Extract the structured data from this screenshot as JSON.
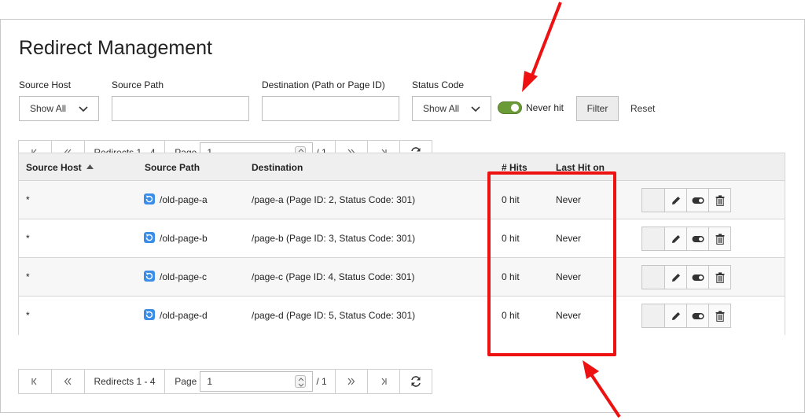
{
  "page": {
    "title": "Redirect Management"
  },
  "filters": {
    "source_host": {
      "label": "Source Host",
      "value": "Show All"
    },
    "source_path": {
      "label": "Source Path",
      "value": ""
    },
    "destination": {
      "label": "Destination (Path or Page ID)",
      "value": ""
    },
    "status_code": {
      "label": "Status Code",
      "value": "Show All"
    },
    "never_hit": {
      "label": "Never hit",
      "on": true
    },
    "filter_label": "Filter",
    "reset_label": "Reset"
  },
  "pager": {
    "range_text": "Redirects 1 - 4",
    "page_label": "Page",
    "page_value": "1",
    "total_text": "/ 1"
  },
  "table": {
    "columns": [
      "Source Host",
      "Source Path",
      "Destination",
      "# Hits",
      "Last Hit on"
    ],
    "sort_column": "Source Host",
    "rows": [
      {
        "host": "*",
        "path": "/old-page-a",
        "dest_path": "/page-a",
        "dest_info": "(Page ID: 2, Status Code: 301)",
        "hits": "0 hit",
        "last_hit": "Never"
      },
      {
        "host": "*",
        "path": "/old-page-b",
        "dest_path": "/page-b",
        "dest_info": "(Page ID: 3, Status Code: 301)",
        "hits": "0 hit",
        "last_hit": "Never"
      },
      {
        "host": "*",
        "path": "/old-page-c",
        "dest_path": "/page-c",
        "dest_info": "(Page ID: 4, Status Code: 301)",
        "hits": "0 hit",
        "last_hit": "Never"
      },
      {
        "host": "*",
        "path": "/old-page-d",
        "dest_path": "/page-d",
        "dest_info": "(Page ID: 5, Status Code: 301)",
        "hits": "0 hit",
        "last_hit": "Never"
      }
    ]
  },
  "colors": {
    "accent_green": "#6b9b37",
    "annotation_red": "#ee1111",
    "icon_blue": "#3b8ee8"
  },
  "icons": [
    "chevron-down-icon",
    "first-page-icon",
    "previous-page-icon",
    "next-page-icon",
    "last-page-icon",
    "reload-icon",
    "redirect-icon",
    "edit-pencil-icon",
    "toggle-icon",
    "trash-icon",
    "sort-asc-icon"
  ]
}
